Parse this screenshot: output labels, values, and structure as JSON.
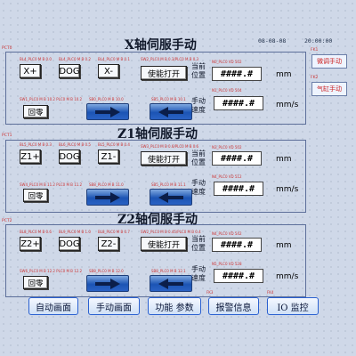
{
  "header": {
    "date": "08-08-08",
    "time": "20:00:00"
  },
  "side": {
    "fk1_tag": "FK1",
    "fk2_tag": "FK2",
    "fine_label": " 微调手动",
    "gas_label": "气缸手动"
  },
  "sections": [
    {
      "pct": "PCT0",
      "title": "X轴伺服手动",
      "tags": {
        "plus": "BL4_PLC0 M B 0.0",
        "dog": "BL4_PLC0 M B 0.2",
        "minus": "BL4_PLC0 M B 0.1",
        "enable": "SW2_PLC0 M B 0.3/PLC0 M B 0.3",
        "pos": "N0_PLC0 VD 502",
        "speed": "N1_PLC0 VD 504",
        "home": "SW1_PLC0 M B 10.2 PLC0 M B 10.2",
        "fwd": "SB0_PLC0 M B 10.0",
        "rev": "SB5_PLC0 M B 10.1"
      },
      "plus_label": "X+",
      "dog_label": "DOG",
      "minus_label": "X-",
      "enable_label": "使能打开",
      "pos_label_1": "当前",
      "pos_label_2": "位置",
      "pos_value": "####.#",
      "pos_unit": "mm",
      "speed_label_1": "手动",
      "speed_label_2": "速度",
      "speed_value": "####.#",
      "speed_unit": "mm/s",
      "home_label": "回零"
    },
    {
      "pct": "PCT1",
      "title": "Z1轴伺服手动",
      "tags": {
        "plus": "BL5_PLC0 M B 0.3",
        "dog": "BL6_PLC0 M B 0.5",
        "minus": "BL5_PLC0 M B 0.4",
        "enable": "SW3_PLC0 M B 0.6/PLC0 M B 0.6",
        "pos": "N3_PLC0 VD 502",
        "speed": "N4_PLC0 VD 512",
        "home": "SW4_PLC0 M B 11.2 PLC0 M B 11.2",
        "fwd": "SB8_PLC0 M B 11.0",
        "rev": "SB5_PLC0 M B 11.1"
      },
      "plus_label": "Z1+",
      "dog_label": "DOG",
      "minus_label": "Z1-",
      "enable_label": "使能打开",
      "pos_label_1": "当前",
      "pos_label_2": "位置",
      "pos_value": "####.#",
      "pos_unit": "mm",
      "speed_label_1": "手动",
      "speed_label_2": "速度",
      "speed_value": "####.#",
      "speed_unit": "mm/s",
      "home_label": "回零"
    },
    {
      "pct": "PCT2",
      "title": "Z2轴伺服手动",
      "tags": {
        "plus": "BL8_PLC0 M B 0.6",
        "dog": "BL9_PLC0 M B 1.0",
        "minus": "BL8_PLC0 M B 0.7",
        "enable": "SW2_PLC0 M B 0.45/PLC0 M B 0.4",
        "pos": "N4_PLC0 VD 542",
        "speed": "N5_PLC0 VD 528",
        "home": "SW6_PLC0 M B 12.2 PLC0 M B 12.2",
        "fwd": "SB8_PLC0 M B 12.0",
        "rev": "SB8_PLC0 M B 12.1"
      },
      "plus_label": "Z2+",
      "dog_label": "DOG",
      "minus_label": "Z2-",
      "enable_label": "使能打开",
      "pos_label_1": "当前",
      "pos_label_2": "位置",
      "pos_value": "####.#",
      "pos_unit": "mm",
      "speed_label_1": "手动",
      "speed_label_2": "速度",
      "speed_value": "####.#",
      "speed_unit": "mm/s",
      "home_label": "回零"
    }
  ],
  "nav": {
    "fk3_tag": "FK3",
    "fk4_tag": "FK4",
    "auto": "自动画面",
    "manual": "手动画面",
    "params": "功能 参数",
    "alarm": "报警信息",
    "io": "IO 监控"
  },
  "colors": {
    "background": "#cfd8e8",
    "tag_red": "#cc3333",
    "arrow_blue": "#1c54b4",
    "nav_border": "#2a60d0"
  }
}
